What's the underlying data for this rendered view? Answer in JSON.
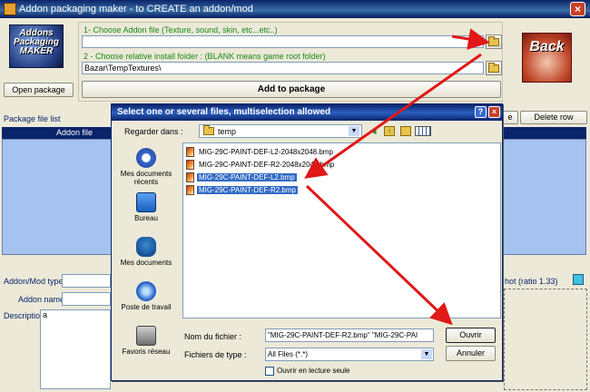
{
  "window": {
    "title": "Addon packaging maker - to CREATE an addon/mod",
    "close": "×"
  },
  "logo": {
    "line1": "Addons",
    "line2": "Packaging",
    "line3": "MAKER"
  },
  "step1": {
    "label": "1- Choose Addon file (Texture, sound, skin, etc...etc..)",
    "value": ""
  },
  "step2": {
    "label": "2 - Choose relative install folder : (BLANK means game root folder)",
    "value": "Bazar\\TempTextures\\"
  },
  "buttons": {
    "open_package": "Open package",
    "add_to_package": "Add to package",
    "back": "Back",
    "delete_row": "Delete row",
    "hidden_btn": "e"
  },
  "package": {
    "list_label": "Package file list",
    "col_addon_file": "Addon file"
  },
  "form": {
    "type_label": "Addon/Mod type",
    "name_label": "Addon name",
    "description_label": "Description",
    "description_value": "a",
    "screenshot_label": "hot (ratio 1.33)"
  },
  "dialog": {
    "title": "Select one or several files, multiselection allowed",
    "help": "?",
    "close": "×",
    "look_in_label": "Regarder dans :",
    "look_in_value": "temp",
    "places": [
      {
        "label": "Mes documents récents",
        "icon": "recent-documents-icon"
      },
      {
        "label": "Bureau",
        "icon": "desktop-icon"
      },
      {
        "label": "Mes documents",
        "icon": "my-documents-icon"
      },
      {
        "label": "Poste de travail",
        "icon": "my-computer-icon"
      },
      {
        "label": "Favoris réseau",
        "icon": "network-places-icon"
      }
    ],
    "files": [
      {
        "name": "MIG-29C-PAINT-DEF-L2-2048x2048.bmp",
        "selected": false
      },
      {
        "name": "MIG-29C-PAINT-DEF-R2-2048x2048.bmp",
        "selected": false
      },
      {
        "name": "MIG-29C-PAINT-DEF-L2.bmp",
        "selected": true
      },
      {
        "name": "MIG-29C-PAINT-DEF-R2.bmp",
        "selected": true
      }
    ],
    "filename_label": "Nom du fichier :",
    "filename_value": "\"MIG-29C-PAINT-DEF-R2.bmp\" \"MIG-29C-PAI",
    "filetype_label": "Fichiers de type :",
    "filetype_value": "All Files (*.*)",
    "readonly_label": "Ouvrir en lecture seule",
    "open_button": "Ouvrir",
    "cancel_button": "Annuler"
  },
  "colors": {
    "selection": "#316ac5",
    "arrow": "#e01818",
    "title_blue": "#0a246a"
  }
}
